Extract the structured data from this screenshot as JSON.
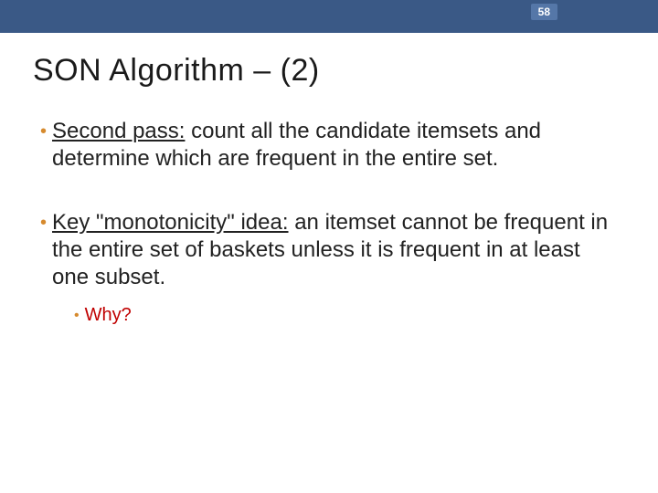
{
  "page_number": "58",
  "title": "SON Algorithm – (2)",
  "bullets": [
    {
      "lead_underlined": "Second pass:",
      "rest": " count all the candidate itemsets and determine which are frequent in the entire set."
    },
    {
      "lead_underlined": "Key \"monotonicity\" idea:",
      "rest": " an itemset cannot be frequent in the entire set of baskets unless it is frequent in at least one subset.",
      "sub": "Why?"
    }
  ]
}
